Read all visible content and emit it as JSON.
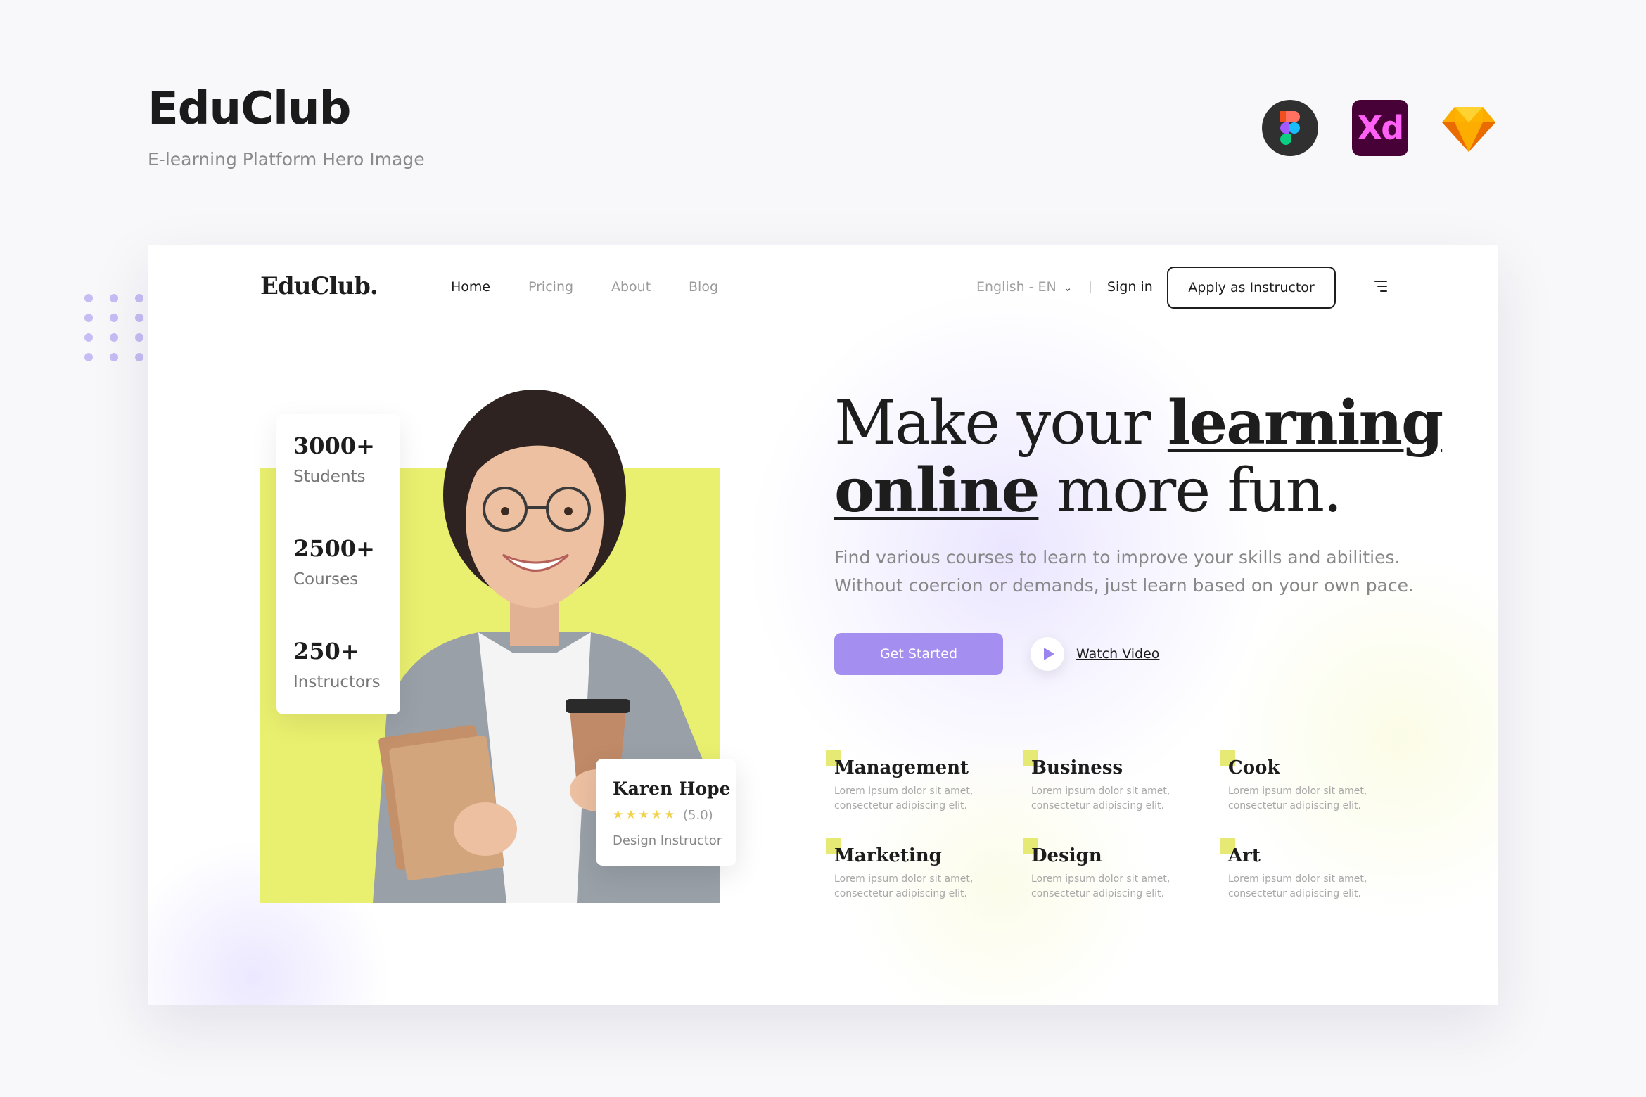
{
  "presentation": {
    "title": "EduClub",
    "subtitle": "E-learning Platform Hero Image",
    "tools": [
      "figma-icon",
      "xd-icon",
      "sketch-icon"
    ],
    "xd_label": "Xd"
  },
  "nav": {
    "logo": "EduClub.",
    "items": [
      "Home",
      "Pricing",
      "About",
      "Blog"
    ],
    "active": "Home",
    "language": "English - EN",
    "signin": "Sign in",
    "apply": "Apply as Instructor"
  },
  "stats": [
    {
      "value": "3000+",
      "label": "Students"
    },
    {
      "value": "2500+",
      "label": "Courses"
    },
    {
      "value": "250+",
      "label": "Instructors"
    }
  ],
  "instructor": {
    "name": "Karen Hope",
    "stars": "★★★★★",
    "rating": "(5.0)",
    "role": "Design Instructor"
  },
  "hero": {
    "headline_1": "Make your ",
    "headline_bold_1": "learning",
    "headline_bold_2": "online",
    "headline_2": " more fun.",
    "description_1": "Find various courses to learn to improve your skills and abilities.",
    "description_2": "Without coercion or demands, just learn based on your own pace.",
    "cta_primary": "Get Started",
    "cta_video": "Watch Video"
  },
  "categories": [
    {
      "name": "Management",
      "desc": "Lorem ipsum dolor sit amet, consectetur adipiscing elit."
    },
    {
      "name": "Business",
      "desc": "Lorem ipsum dolor sit amet, consectetur adipiscing elit."
    },
    {
      "name": "Cook",
      "desc": "Lorem ipsum dolor sit amet, consectetur adipiscing elit."
    },
    {
      "name": "Marketing",
      "desc": "Lorem ipsum dolor sit amet, consectetur adipiscing elit."
    },
    {
      "name": "Design",
      "desc": "Lorem ipsum dolor sit amet, consectetur adipiscing elit."
    },
    {
      "name": "Art",
      "desc": "Lorem ipsum dolor sit amet, consectetur adipiscing elit."
    }
  ],
  "colors": {
    "accent_purple": "#a48ef0",
    "accent_yellow": "#e9ef6e",
    "text_dark": "#1d1d1d"
  }
}
